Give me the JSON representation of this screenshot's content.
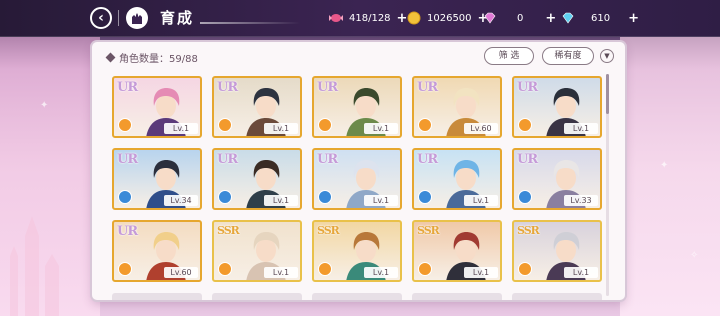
{
  "header": {
    "title": "育成",
    "resources": [
      {
        "icon": "candy-icon",
        "value": "418/128",
        "color": "#e8578a"
      },
      {
        "icon": "gold-coin-icon",
        "value": "1026500",
        "color": "#f2c23a"
      },
      {
        "icon": "pink-gem-icon",
        "value": "0",
        "color": "#e07ad6"
      },
      {
        "icon": "blue-gem-icon",
        "value": "610",
        "color": "#5fd0f0"
      }
    ]
  },
  "panel": {
    "count_label": "角色数量：59/88",
    "filter_label": "筛 选",
    "rarity_label": "稀有度"
  },
  "characters": [
    {
      "rarity": "UR",
      "level": "Lv.1",
      "element": "orange",
      "hair": "#e58bb4",
      "bg": "#f5d6e3",
      "outfit": "#5b3a7a"
    },
    {
      "rarity": "UR",
      "level": "Lv.1",
      "element": "orange",
      "hair": "#2d3340",
      "bg": "#e5dbc9",
      "outfit": "#6b4a3a"
    },
    {
      "rarity": "UR",
      "level": "Lv.1",
      "element": "orange",
      "hair": "#3b4a2d",
      "bg": "#ecd9b9",
      "outfit": "#6c8a4a"
    },
    {
      "rarity": "UR",
      "level": "Lv.60",
      "element": "orange",
      "hair": "#f2e3c1",
      "bg": "#f0d9b3",
      "outfit": "#c88a3a"
    },
    {
      "rarity": "UR",
      "level": "Lv.1",
      "element": "orange",
      "hair": "#2a2f3a",
      "bg": "#cfdbe8",
      "outfit": "#3a3445"
    },
    {
      "rarity": "UR",
      "level": "Lv.34",
      "element": "blue",
      "hair": "#2b2f3d",
      "bg": "#b8d4ee",
      "outfit": "#2f4e8a"
    },
    {
      "rarity": "UR",
      "level": "Lv.1",
      "element": "blue",
      "hair": "#3a2c25",
      "bg": "#c9dce8",
      "outfit": "#2f3f4a"
    },
    {
      "rarity": "UR",
      "level": "Lv.1",
      "element": "blue",
      "hair": "#dde3ee",
      "bg": "#cfe0f2",
      "outfit": "#8fa8c8"
    },
    {
      "rarity": "UR",
      "level": "Lv.1",
      "element": "blue",
      "hair": "#6fb4e6",
      "bg": "#c7e2f4",
      "outfit": "#4a6a9a"
    },
    {
      "rarity": "UR",
      "level": "Lv.33",
      "element": "blue",
      "hair": "#e9e6e6",
      "bg": "#d7d9ea",
      "outfit": "#8a7fa0"
    },
    {
      "rarity": "UR",
      "level": "Lv.60",
      "element": "orange",
      "hair": "#f1cf8a",
      "bg": "#f4dcc1",
      "outfit": "#b0402e"
    },
    {
      "rarity": "SSR",
      "level": "Lv.1",
      "element": "orange",
      "hair": "#e6d5bf",
      "bg": "#f1e2cd",
      "outfit": "#d8c3b2"
    },
    {
      "rarity": "SSR",
      "level": "Lv.1",
      "element": "orange",
      "hair": "#b8783a",
      "bg": "#f2d7a3",
      "outfit": "#3a8a7a"
    },
    {
      "rarity": "SSR",
      "level": "Lv.1",
      "element": "orange",
      "hair": "#a13b32",
      "bg": "#f0c9a8",
      "outfit": "#2f2f3a"
    },
    {
      "rarity": "SSR",
      "level": "Lv.1",
      "element": "orange",
      "hair": "#cfcfd6",
      "bg": "#d8d2dc",
      "outfit": "#4a3a55"
    }
  ]
}
